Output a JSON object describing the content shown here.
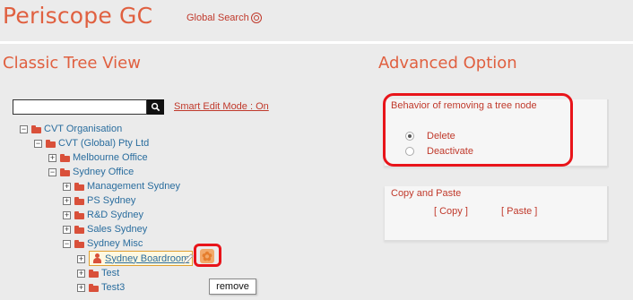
{
  "header": {
    "app_title": "Periscope GC",
    "global_search_label": "Global Search"
  },
  "left": {
    "title": "Classic Tree View",
    "search": {
      "value": "",
      "placeholder": ""
    },
    "smart_edit_label": "Smart Edit Mode : On",
    "tree": [
      {
        "label": "CVT Organisation",
        "expanded": true,
        "icon": "folder-icon"
      },
      {
        "label": "CVT (Global) Pty Ltd",
        "expanded": true,
        "icon": "folder-icon"
      },
      {
        "label": "Melbourne Office",
        "expanded": false,
        "icon": "folder-icon"
      },
      {
        "label": "Sydney Office",
        "expanded": true,
        "icon": "folder-icon"
      },
      {
        "label": "Management Sydney",
        "expanded": false,
        "icon": "folder-icon"
      },
      {
        "label": "PS Sydney",
        "expanded": false,
        "icon": "folder-icon"
      },
      {
        "label": "R&D Sydney",
        "expanded": false,
        "icon": "folder-icon"
      },
      {
        "label": "Sales Sydney",
        "expanded": false,
        "icon": "folder-icon"
      },
      {
        "label": "Sydney Misc",
        "expanded": true,
        "icon": "folder-icon"
      },
      {
        "label": "Sydney Boardroom",
        "expanded": false,
        "icon": "person-icon",
        "selected": true
      },
      {
        "label": "Test",
        "expanded": false,
        "icon": "folder-icon"
      },
      {
        "label": "Test3",
        "expanded": false,
        "icon": "folder-icon"
      }
    ],
    "tooltip": "remove",
    "remove_icon": "remove-icon"
  },
  "right": {
    "title": "Advanced Option",
    "behavior": {
      "title": "Behavior of removing a tree node",
      "options": [
        {
          "label": "Delete",
          "checked": true
        },
        {
          "label": "Deactivate",
          "checked": false
        }
      ]
    },
    "copy_paste": {
      "title": "Copy and Paste",
      "copy_label": "[ Copy ]",
      "paste_label": "[ Paste ]"
    }
  },
  "colors": {
    "accent": "#e06040",
    "link": "#2a6d9e",
    "highlight": "#e8141a"
  }
}
